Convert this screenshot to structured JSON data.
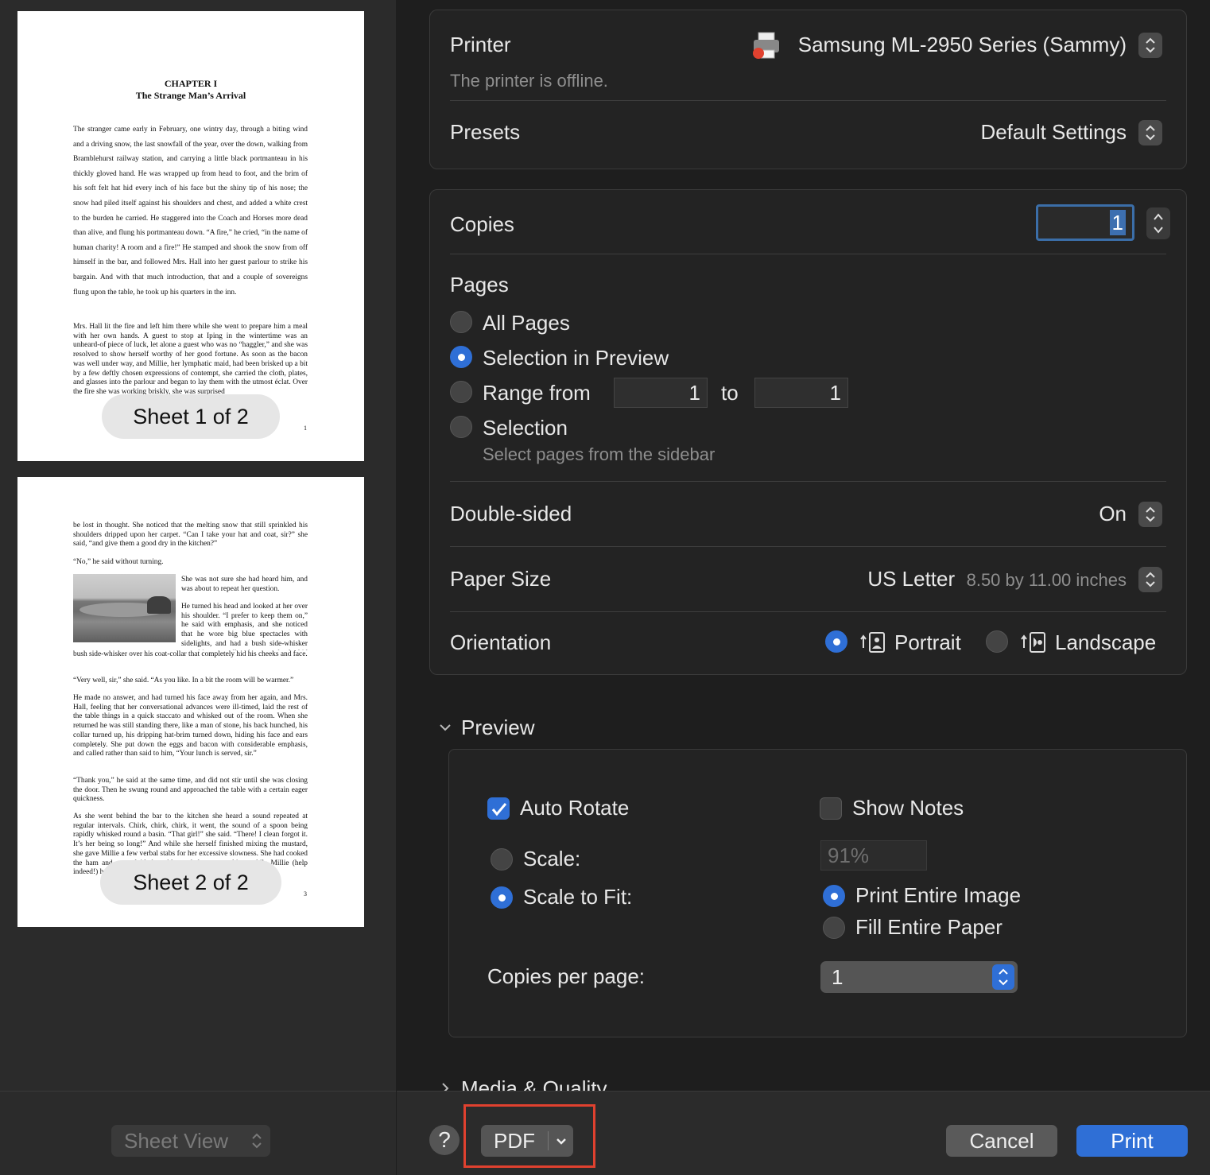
{
  "sidebar": {
    "sheet1": {
      "chapter": "CHAPTER I",
      "chapter_title": "The Strange Man’s Arrival",
      "para1": "The stranger came early in February, one wintry day, through a biting wind and a driving snow, the last snowfall of the year, over the down, walking from Bramblehurst railway station, and carrying a little black portmanteau in his thickly gloved hand. He was wrapped up from head to foot, and the brim of his soft felt hat hid every inch of his face but the shiny tip of his nose; the snow had piled itself against his shoulders and chest, and added a white crest to the burden he carried. He staggered into the Coach and Horses more dead than alive, and flung his portmanteau down. “A fire,” he cried, “in the name of human charity! A room and a fire!” He stamped and shook the snow from off himself in the bar, and followed Mrs. Hall into her guest parlour to strike his bargain. And with that much introduction, that and a couple of sovereigns flung upon the table, he took up his quarters in the inn.",
      "para2": "Mrs. Hall lit the fire and left him there while she went to prepare him a meal with her own hands. A guest to stop at Iping in the wintertime was an unheard-of piece of luck, let alone a guest who was no “haggler,” and she was resolved to show herself worthy of her good fortune. As soon as the bacon was well under way, and Millie, her lymphatic maid, had been brisked up a bit by a few deftly chosen expressions of contempt, she carried the cloth, plates, and glasses into the parlour and began to lay them with the utmost éclat. Over the fire she was working briskly, she was surprised",
      "page_num": "1",
      "badge": "Sheet 1 of 2"
    },
    "sheet2": {
      "p1": "be lost in thought. She noticed that the melting snow that still sprinkled his shoulders dripped upon her carpet. “Can I take your hat and coat, sir?” she said, “and give them a good dry in the kitchen?”",
      "p2": "“No,” he said without turning.",
      "p3": "She was not sure she had heard him, and was about to repeat her question.",
      "p4": "He turned his head and looked at her over his shoulder. “I prefer to keep them on,” he said with emphasis, and she noticed that he wore big blue spectacles with sidelights, and had a bush side-whisker over his coat-collar that completely hid his cheeks and face.",
      "p5": "“Very well, sir,” she said. “As you like. In a bit the room will be warmer.”",
      "p6": "He made no answer, and had turned his face away from her again, and Mrs. Hall, feeling that her conversational advances were ill-timed, laid the rest of the table things in a quick staccato and whisked out of the room. When she returned he was still standing there, like a man of stone, his back hunched, his collar turned up, his dripping hat-brim turned down, hiding his face and ears completely. She put down the eggs and bacon with considerable emphasis, and called rather than said to him, “Your lunch is served, sir.”",
      "p7": "“Thank you,” he said at the same time, and did not stir until she was closing the door. Then he swung round and approached the table with a certain eager quickness.",
      "p8": "As she went behind the bar to the kitchen she heard a sound repeated at regular intervals. Chirk, chirk, chirk, it went, the sound of a spoon being rapidly whisked round a basin. “That girl!” she said. “There! I clean forgot it. It’s her being so long!” And while she herself finished mixing the mustard, she gave Millie a few verbal stabs for her excessive slowness. She had cooked the ham and eggs, laid the table, and done everything, while Millie (help indeed!) had only succeeded in delaying",
      "page_num": "3",
      "badge": "Sheet 2 of 2"
    },
    "sheet_view": "Sheet View"
  },
  "printer": {
    "label": "Printer",
    "value": "Samsung ML-2950 Series (Sammy)",
    "status": "The printer is offline."
  },
  "presets": {
    "label": "Presets",
    "value": "Default Settings"
  },
  "copies": {
    "label": "Copies",
    "value": "1"
  },
  "pages": {
    "label": "Pages",
    "all": "All Pages",
    "selection_preview": "Selection in Preview",
    "range_from": "Range from",
    "range_start": "1",
    "to": "to",
    "range_end": "1",
    "selection": "Selection",
    "selection_hint": "Select pages from the sidebar"
  },
  "double_sided": {
    "label": "Double-sided",
    "value": "On"
  },
  "paper_size": {
    "label": "Paper Size",
    "value": "US Letter",
    "detail": "8.50 by 11.00 inches"
  },
  "orientation": {
    "label": "Orientation",
    "portrait": "Portrait",
    "landscape": "Landscape"
  },
  "preview": {
    "section": "Preview",
    "auto_rotate": "Auto Rotate",
    "show_notes": "Show Notes",
    "scale": "Scale:",
    "scale_value": "91%",
    "scale_to_fit": "Scale to Fit:",
    "print_entire": "Print Entire Image",
    "fill_entire": "Fill Entire Paper",
    "copies_per_page": "Copies per page:",
    "copies_per_page_value": "1"
  },
  "media_quality": "Media & Quality",
  "footer": {
    "help": "?",
    "pdf": "PDF",
    "cancel": "Cancel",
    "print": "Print"
  },
  "colors": {
    "accent": "#2f6fd6",
    "highlight": "#e0412f"
  }
}
